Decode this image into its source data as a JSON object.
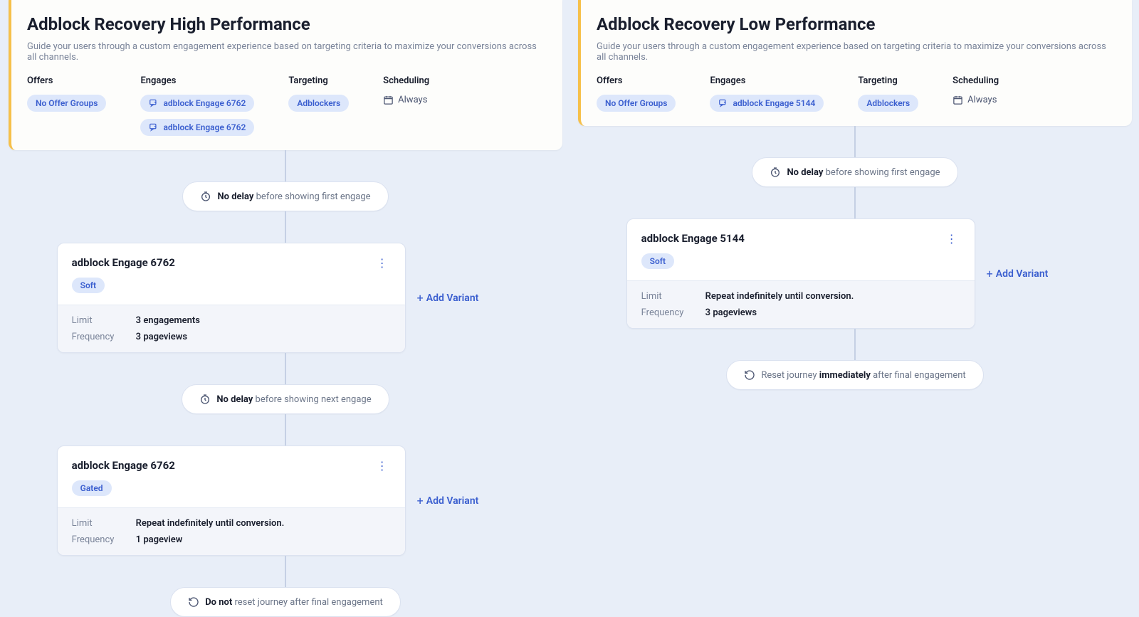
{
  "left": {
    "title": "Adblock Recovery High Performance",
    "subtitle": "Guide your users through a custom engagement experience based on targeting criteria to maximize your conversions across all channels.",
    "meta": {
      "offers_label": "Offers",
      "offers_chip": "No Offer Groups",
      "engages_label": "Engages",
      "engages": [
        "adblock Engage 6762",
        "adblock Engage 6762"
      ],
      "targeting_label": "Targeting",
      "targeting_chip": "Adblockers",
      "scheduling_label": "Scheduling",
      "scheduling_value": "Always"
    },
    "delay1": {
      "bold": "No delay",
      "rest": " before showing first engage"
    },
    "stage1": {
      "name": "adblock Engage 6762",
      "tag": "Soft",
      "limit_label": "Limit",
      "limit_value": "3 engagements",
      "freq_label": "Frequency",
      "freq_value": "3 pageviews",
      "add": "Add Variant"
    },
    "delay2": {
      "bold": "No delay",
      "rest": " before showing next engage"
    },
    "stage2": {
      "name": "adblock Engage 6762",
      "tag": "Gated",
      "limit_label": "Limit",
      "limit_value": "Repeat indefinitely until conversion.",
      "freq_label": "Frequency",
      "freq_value": "1 pageview",
      "add": "Add Variant"
    },
    "reset": {
      "bold": "Do not",
      "rest": " reset journey after final engagement"
    }
  },
  "right": {
    "title": "Adblock Recovery Low Performance",
    "subtitle": "Guide your users through a custom engagement experience based on targeting criteria to maximize your conversions across all channels.",
    "meta": {
      "offers_label": "Offers",
      "offers_chip": "No Offer Groups",
      "engages_label": "Engages",
      "engages": [
        "adblock Engage 5144"
      ],
      "targeting_label": "Targeting",
      "targeting_chip": "Adblockers",
      "scheduling_label": "Scheduling",
      "scheduling_value": "Always"
    },
    "delay1": {
      "bold": "No delay",
      "rest": " before showing first engage"
    },
    "stage1": {
      "name": "adblock Engage 5144",
      "tag": "Soft",
      "limit_label": "Limit",
      "limit_value": "Repeat indefinitely until conversion.",
      "freq_label": "Frequency",
      "freq_value": "3 pageviews",
      "add": "Add Variant"
    },
    "reset": {
      "pre": "Reset journey ",
      "bold": "immediately",
      "post": " after final engagement"
    }
  }
}
